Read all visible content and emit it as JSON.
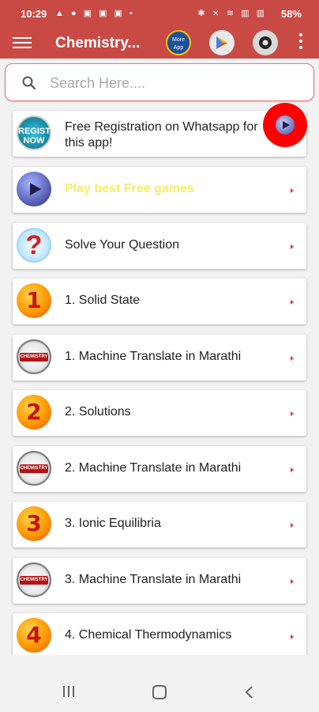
{
  "status_bar": {
    "time": "10:29",
    "left_icons": "▲ ● ▣ ▣ ▣ •",
    "right_icons": "✱ ⨯ ≋ ▥ ▥",
    "battery": "58%"
  },
  "app_bar": {
    "title": "Chemistry...",
    "icons": [
      "menu-icon",
      "more-app-icon",
      "play-store-icon",
      "share-icon",
      "overflow-menu-icon"
    ],
    "more_app_label": "More App"
  },
  "search": {
    "placeholder": "Search Here...."
  },
  "list": {
    "items": [
      {
        "label": "Free Registration on Whatsapp for this app!",
        "icon": "register-now-icon",
        "icon_text": "REGISTER NOW"
      },
      {
        "label": "Play best Free games",
        "icon": "play-icon"
      },
      {
        "label": "Solve Your Question",
        "icon": "question-icon",
        "icon_text": "?"
      },
      {
        "label": "1. Solid State",
        "icon": "number-icon",
        "icon_text": "1"
      },
      {
        "label": "1. Machine Translate in Marathi",
        "icon": "chemistry-badge-icon",
        "icon_text": "CHEMISTRY"
      },
      {
        "label": "2. Solutions",
        "icon": "number-icon",
        "icon_text": "2"
      },
      {
        "label": "2. Machine Translate in Marathi",
        "icon": "chemistry-badge-icon",
        "icon_text": "CHEMISTRY"
      },
      {
        "label": "3. Ionic Equilibria",
        "icon": "number-icon",
        "icon_text": "3"
      },
      {
        "label": "3. Machine Translate in Marathi",
        "icon": "chemistry-badge-icon",
        "icon_text": "CHEMISTRY"
      },
      {
        "label": "4. Chemical Thermodynamics",
        "icon": "number-icon",
        "icon_text": "4"
      }
    ]
  },
  "colors": {
    "app_bar": "#c94a45",
    "accent_red": "#e53935",
    "floating_button": "#ff0000",
    "games_label": "#f4ec6a"
  }
}
